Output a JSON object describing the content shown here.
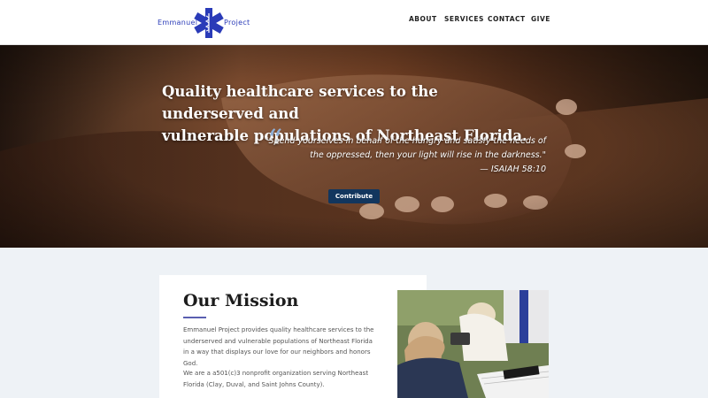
{
  "header": {
    "logo": {
      "word_left": "Emmanuel",
      "word_right": "Project"
    },
    "nav": [
      "ABOUT",
      "SERVICES",
      "CONTACT",
      "GIVE"
    ]
  },
  "hero": {
    "title_line1": "Quality healthcare services to the underserved and",
    "title_line2": "vulnerable populations of Northeast Florida.",
    "quote_mark": "“",
    "quote_line1": "\"Spend yourselves in behalf of the hungry and satisfy the needs of",
    "quote_line2": "the oppressed, then your light will rise in the darkness.\"",
    "quote_source": "— ISAIAH 58:10",
    "cta_label": "Contribute"
  },
  "mission": {
    "title": "Our Mission",
    "paragraph1": "Emmanuel Project provides quality healthcare services to the underserved and vulnerable populations of Northeast Florida in a way that displays our love for our neighbors and honors God.",
    "paragraph2": "We are a a501(c)3 nonprofit organization serving Northeast Florida (Clay, Duval, and Saint Johns County)."
  },
  "colors": {
    "brand_blue": "#2a3bb8",
    "button": "#12365e",
    "accent_rule": "#5a5fb0"
  }
}
